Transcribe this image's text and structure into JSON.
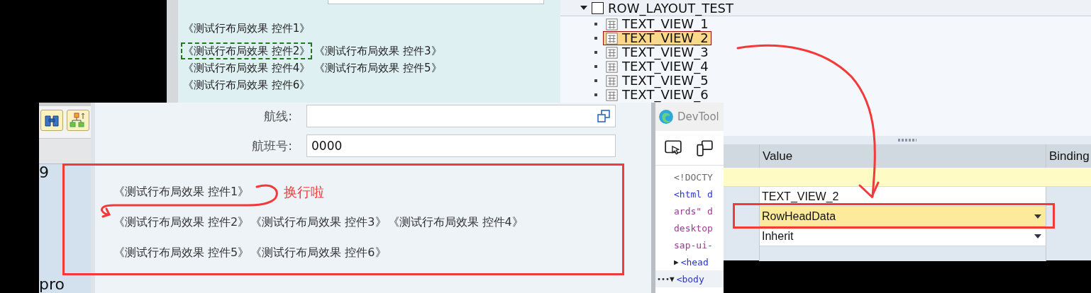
{
  "preview": {
    "lines": [
      [
        {
          "text": "《测试行布局效果 控件1》",
          "selected": false
        }
      ],
      [
        {
          "text": "《测试行布局效果 控件2》",
          "selected": true
        },
        {
          "text": "《测试行布局效果 控件3》",
          "selected": false
        }
      ],
      [
        {
          "text": "《测试行布局效果 控件4》",
          "selected": false
        },
        {
          "text": "《测试行布局效果 控件5》",
          "selected": false
        }
      ],
      [
        {
          "text": "《测试行布局效果 控件6》",
          "selected": false
        }
      ]
    ]
  },
  "tree": {
    "label": "ROW_LAYOUT_TEST",
    "expanded": true,
    "checked": false,
    "children": [
      {
        "label": "TEXT_VIEW_1",
        "selected": false
      },
      {
        "label": "TEXT_VIEW_2",
        "selected": true
      },
      {
        "label": "TEXT_VIEW_3",
        "selected": false
      },
      {
        "label": "TEXT_VIEW_4",
        "selected": false
      },
      {
        "label": "TEXT_VIEW_5",
        "selected": false
      },
      {
        "label": "TEXT_VIEW_6",
        "selected": false
      }
    ]
  },
  "app": {
    "side_texts": [
      "9",
      "pro"
    ],
    "fields": [
      {
        "label": "航线:",
        "kind": "help"
      },
      {
        "label": "航班号:",
        "value": "0000",
        "kind": "plain"
      }
    ],
    "layout_rows": [
      [
        "《测试行布局效果 控件1》"
      ],
      [
        "《测试行布局效果 控件2》",
        "《测试行布局效果 控件3》",
        "《测试行布局效果 控件4》"
      ],
      [
        "《测试行布局效果 控件5》",
        "《测试行布局效果 控件6》"
      ]
    ],
    "note": "换行啦"
  },
  "devtools": {
    "title": "DevTool",
    "code_lines": [
      {
        "kind": "doctype",
        "text": "<!DOCTY"
      },
      {
        "kind": "tag",
        "text": "<html d"
      },
      {
        "kind": "attr",
        "text": "ards\" d"
      },
      {
        "kind": "attr",
        "text": "desktop"
      },
      {
        "kind": "attr",
        "text": "sap-ui-"
      },
      {
        "kind": "tag",
        "toggle": "▶",
        "text": "<head"
      },
      {
        "kind": "tag",
        "gutter": "•••",
        "toggle": "▼",
        "text": "<body"
      }
    ]
  },
  "properties": {
    "columns": [
      "Value",
      "Binding"
    ],
    "rows": [
      {
        "kind": "highlight"
      },
      {
        "kind": "text",
        "value": "TEXT_VIEW_2",
        "selected": false
      },
      {
        "kind": "dropdown",
        "value": "RowHeadData",
        "selected": true
      },
      {
        "kind": "dropdown",
        "value": "Inherit",
        "selected": false
      }
    ]
  }
}
